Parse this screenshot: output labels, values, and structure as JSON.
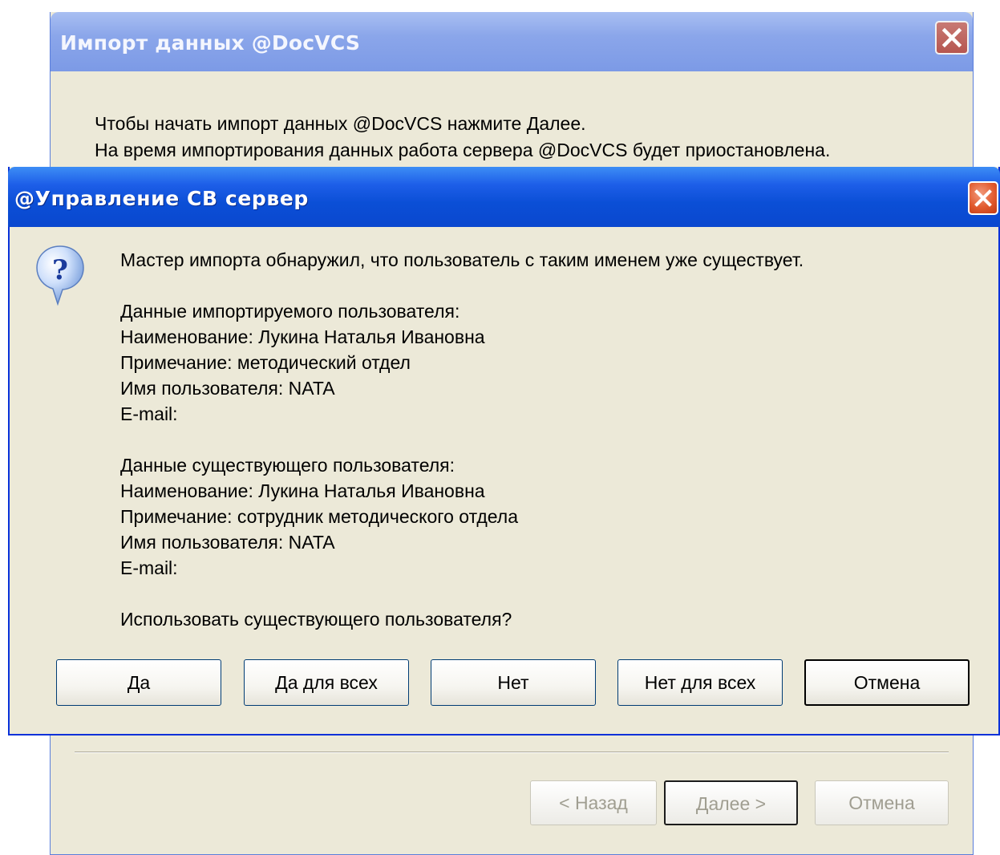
{
  "back_window": {
    "title": "Импорт данных @DocVCS",
    "intro_lines": [
      "Чтобы начать импорт данных @DocVCS нажмите Далее.",
      "На время импортирования данных работа сервера @DocVCS будет приостановлена."
    ],
    "buttons": {
      "back": "< Назад",
      "next": "Далее >",
      "cancel": "Отмена"
    }
  },
  "dialog": {
    "title": "@Управление СВ сервер",
    "icon": "question-icon",
    "message": "Мастер импорта обнаружил, что пользователь с таким именем уже существует.",
    "imported_user": {
      "header": "Данные импортируемого пользователя:",
      "name": "Наименование: Лукина Наталья Ивановна",
      "note": "Примечание: методический отдел",
      "username": "Имя пользователя: NATA",
      "email": "E-mail:"
    },
    "existing_user": {
      "header": "Данные существующего пользователя:",
      "name": "Наименование: Лукина Наталья Ивановна",
      "note": "Примечание: сотрудник методического отдела",
      "username": "Имя пользователя: NATA",
      "email": "E-mail:"
    },
    "question": "Использовать существующего пользователя?",
    "buttons": {
      "yes": "Да",
      "yes_all": "Да для всех",
      "no": "Нет",
      "no_all": "Нет для всех",
      "cancel": "Отмена"
    }
  },
  "colors": {
    "dialog_face": "#ece9d8",
    "active_title": "#0b4fd6",
    "inactive_title": "#8ba6ea",
    "close_red": "#e15a2e"
  }
}
